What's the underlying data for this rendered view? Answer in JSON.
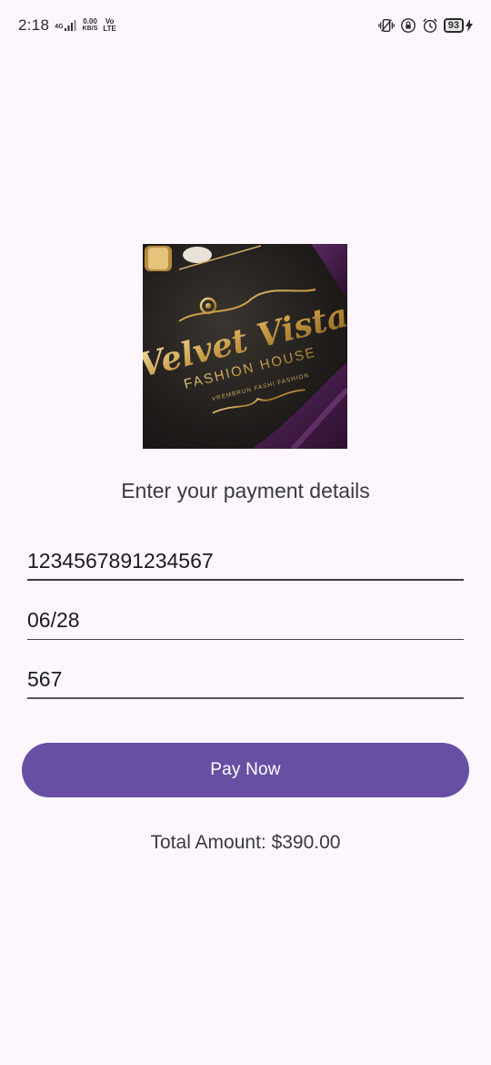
{
  "status_bar": {
    "time": "2:18",
    "network_type": "4G",
    "data_speed_value": "0.00",
    "data_speed_unit": "KB/S",
    "volte_top": "Vo",
    "volte_bottom": "LTE",
    "battery_level": "93",
    "icons": [
      "vibrate-icon",
      "lock-rotation-icon",
      "alarm-icon",
      "battery-icon",
      "charging-icon"
    ]
  },
  "logo": {
    "brand_line1": "Velvet Vista",
    "brand_line2": "FASHION HOUSE",
    "brand_line3": "VREMBRUN FASHI FASHION"
  },
  "payment": {
    "heading": "Enter your payment details",
    "card_number": "1234567891234567",
    "expiry": "06/28",
    "cvv": "567",
    "pay_button_label": "Pay Now",
    "total_text": "Total Amount: $390.00"
  },
  "colors": {
    "background": "#fdf7fd",
    "primary": "#6750a4",
    "text": "#1c1b1f"
  }
}
